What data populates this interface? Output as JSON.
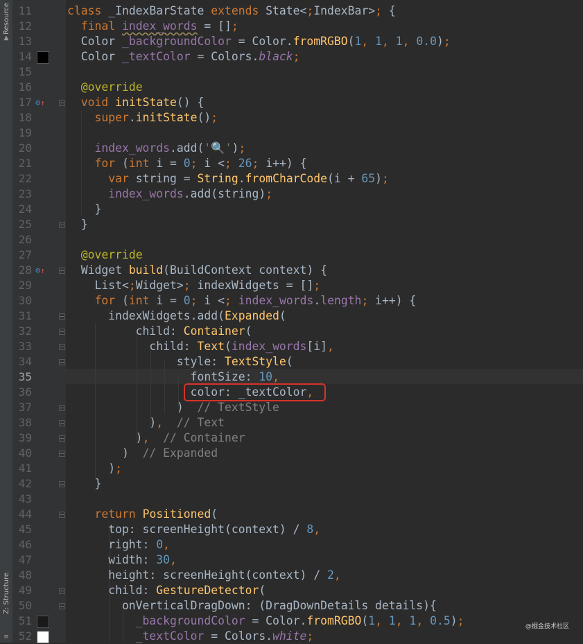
{
  "sidebar": {
    "tabs": [
      {
        "label": "Resource",
        "icon": "resource-manager-icon"
      },
      {
        "label": "Z: Structure",
        "icon": "structure-icon"
      }
    ]
  },
  "editor": {
    "current_line": "35",
    "swatch_colors": {
      "14": "#000000",
      "51": "#1a1a1a",
      "52": "#ffffff"
    },
    "lines": [
      {
        "n": "11",
        "t": "class _IndexBarState extends State<IndexBar> {"
      },
      {
        "n": "12",
        "t": "  final index_words = [];"
      },
      {
        "n": "13",
        "t": "  Color _backgroundColor = Color.fromRGBO(1, 1, 1, 0.0);"
      },
      {
        "n": "14",
        "t": "  Color _textColor = Colors.black;"
      },
      {
        "n": "15",
        "t": ""
      },
      {
        "n": "16",
        "t": "  @override"
      },
      {
        "n": "17",
        "t": "  void initState() {"
      },
      {
        "n": "18",
        "t": "    super.initState();"
      },
      {
        "n": "19",
        "t": ""
      },
      {
        "n": "20",
        "t": "    index_words.add('🔍');"
      },
      {
        "n": "21",
        "t": "    for (int i = 0; i < 26; i++) {"
      },
      {
        "n": "22",
        "t": "      var string = String.fromCharCode(i + 65);"
      },
      {
        "n": "23",
        "t": "      index_words.add(string);"
      },
      {
        "n": "24",
        "t": "    }"
      },
      {
        "n": "25",
        "t": "  }"
      },
      {
        "n": "26",
        "t": ""
      },
      {
        "n": "27",
        "t": "  @override"
      },
      {
        "n": "28",
        "t": "  Widget build(BuildContext context) {"
      },
      {
        "n": "29",
        "t": "    List<Widget> indexWidgets = [];"
      },
      {
        "n": "30",
        "t": "    for (int i = 0; i < index_words.length; i++) {"
      },
      {
        "n": "31",
        "t": "      indexWidgets.add(Expanded("
      },
      {
        "n": "32",
        "t": "          child: Container("
      },
      {
        "n": "33",
        "t": "            child: Text(index_words[i],"
      },
      {
        "n": "34",
        "t": "                style: TextStyle("
      },
      {
        "n": "35",
        "t": "                  fontSize: 10,"
      },
      {
        "n": "36",
        "t": "                  color: _textColor,"
      },
      {
        "n": "37",
        "t": "                )  // TextStyle"
      },
      {
        "n": "38",
        "t": "            ),  // Text"
      },
      {
        "n": "39",
        "t": "          ),  // Container"
      },
      {
        "n": "40",
        "t": "        )  // Expanded"
      },
      {
        "n": "41",
        "t": "      );"
      },
      {
        "n": "42",
        "t": "    }"
      },
      {
        "n": "43",
        "t": ""
      },
      {
        "n": "44",
        "t": "    return Positioned("
      },
      {
        "n": "45",
        "t": "      top: screenHeight(context) / 8,"
      },
      {
        "n": "46",
        "t": "      right: 0,"
      },
      {
        "n": "47",
        "t": "      width: 30,"
      },
      {
        "n": "48",
        "t": "      height: screenHeight(context) / 2,"
      },
      {
        "n": "49",
        "t": "      child: GestureDetector("
      },
      {
        "n": "50",
        "t": "        onVerticalDragDown: (DragDownDetails details){"
      },
      {
        "n": "51",
        "t": "          _backgroundColor = Color.fromRGBO(1, 1, 1, 0.5);"
      },
      {
        "n": "52",
        "t": "          _textColor = Colors.white;"
      }
    ]
  },
  "watermark": "@掘金技术社区"
}
